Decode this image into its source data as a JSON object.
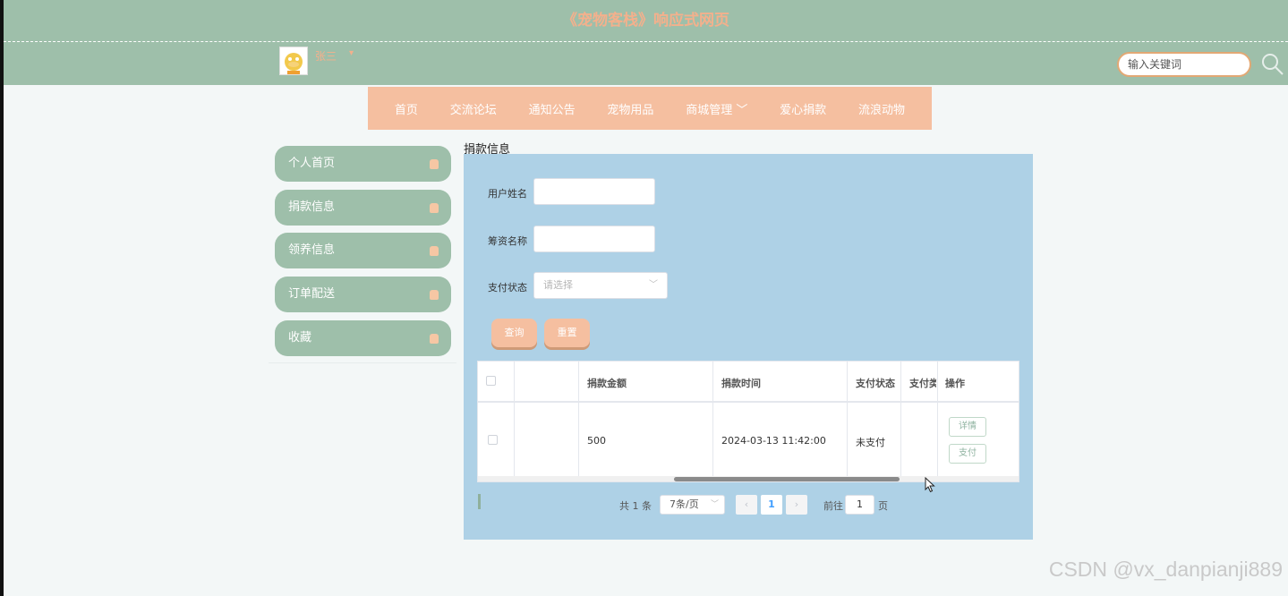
{
  "header": {
    "title": "《宠物客栈》响应式网页",
    "username": "张三",
    "user_caret": "▾",
    "search": {
      "placeholder": "输入关键词"
    }
  },
  "nav": {
    "items": [
      "首页",
      "交流论坛",
      "通知公告",
      "宠物用品",
      "商城管理 ﹀",
      "爱心捐款",
      "流浪动物"
    ]
  },
  "sidebar": {
    "items": [
      "个人首页",
      "捐款信息",
      "领养信息",
      "订单配送",
      "收藏"
    ]
  },
  "main": {
    "section_title": "捐款信息",
    "form": {
      "user_name_label": "用户姓名",
      "fund_name_label": "筹资名称",
      "pay_status_label": "支付状态",
      "pay_status_placeholder": "请选择",
      "search_button": "查询",
      "reset_button": "重置"
    },
    "table": {
      "columns": [
        "",
        "",
        "捐款金额",
        "捐款时间",
        "支付状态",
        "支付类型",
        "操作"
      ],
      "rows": [
        {
          "amount": "500",
          "time": "2024-03-13 11:42:00",
          "status": "未支付",
          "type": "",
          "actions": [
            "详情",
            "支付"
          ]
        }
      ]
    },
    "pagination": {
      "total": "共 1 条",
      "page_size": "7条/页",
      "prev": "‹",
      "current_page": "1",
      "next": "›",
      "goto_label": "前往",
      "goto_value": "1",
      "page_unit": "页"
    }
  },
  "watermark": "CSDN @vx_danpianji889",
  "colors": {
    "header_bg": "#9ebfaa",
    "nav_bg": "#f5bfa0",
    "panel_bg": "#aed1e6",
    "accent_text": "#f4b08c"
  }
}
